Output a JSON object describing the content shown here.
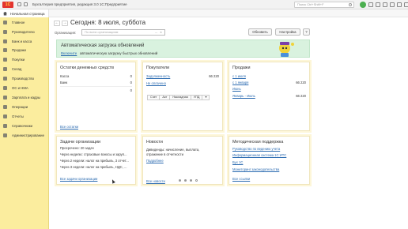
{
  "app": {
    "logo": "1С",
    "title": "Бухгалтерия предприятия, редакция 3.0 1С:Предприятие",
    "search_placeholder": "Поиск Ctrl+Shift+F"
  },
  "tabs": {
    "home": "Начальная страница"
  },
  "sidebar": {
    "items": [
      {
        "label": "Главное",
        "icon": "menu-icon"
      },
      {
        "label": "Руководителю",
        "icon": "chart-icon"
      },
      {
        "label": "Банк и касса",
        "icon": "bank-icon"
      },
      {
        "label": "Продажи",
        "icon": "cart-icon"
      },
      {
        "label": "Покупки",
        "icon": "basket-icon"
      },
      {
        "label": "Склад",
        "icon": "warehouse-icon"
      },
      {
        "label": "Производство",
        "icon": "factory-icon"
      },
      {
        "label": "ОС и НМА",
        "icon": "assets-icon"
      },
      {
        "label": "Зарплата и кадры",
        "icon": "person-icon"
      },
      {
        "label": "Операции",
        "icon": "operations-icon"
      },
      {
        "label": "Отчеты",
        "icon": "report-icon"
      },
      {
        "label": "Справочники",
        "icon": "book-icon"
      },
      {
        "label": "Администрирование",
        "icon": "gear-icon"
      }
    ]
  },
  "main": {
    "back": "←",
    "forward": "→",
    "title": "Сегодня: 8 июля, суббота",
    "org_label": "Организация:",
    "org_placeholder": "По всем организациям",
    "org_dots": "...",
    "org_clear": "×",
    "refresh_btn": "Обновить",
    "settings_btn": "Настройка",
    "help_btn": "?"
  },
  "banner": {
    "title": "Автоматическая загрузка обновлений",
    "link": "Включите",
    "text": "автоматическую загрузку быстрых обновлений"
  },
  "panels": {
    "cash": {
      "title": "Остатки денежных средств",
      "rows": [
        {
          "label": "Касса",
          "value": "0"
        },
        {
          "label": "Банк",
          "value": "0"
        },
        {
          "label": "",
          "value": "0"
        }
      ],
      "link": "Все остатки"
    },
    "buyers": {
      "title": "Покупатели",
      "rows": [
        {
          "label": "Задолженность",
          "value": "66 220"
        },
        {
          "label": "Не оплачено",
          "value": ""
        }
      ],
      "tabs": [
        "Счет",
        "Акт",
        "Накладная",
        "УПД",
        "▾"
      ]
    },
    "sales": {
      "title": "Продажи",
      "rows": [
        {
          "label": "с 1 июля",
          "value": ""
        },
        {
          "label": "с 1 января",
          "value": "66 220"
        },
        {
          "label": "Июнь",
          "value": ""
        },
        {
          "label": "Январь - Июль",
          "value": "66 220"
        }
      ]
    },
    "tasks": {
      "title": "Задачи организации",
      "rows": [
        "Просрочено: 20 задач",
        "Через неделю: страховые взносы и заруп...",
        "Через 2 недели: налог на прибыль, 3 отчет...",
        "Через 3 недели: налог на прибыль, НДС, ..."
      ],
      "link": "Все задачи организации"
    },
    "news": {
      "title": "Новости",
      "text1": "Дивиденды: начисление, выплата,",
      "text2": "отражение в отчетности",
      "link_more": "Подробнее",
      "link_all": "Все новости"
    },
    "support": {
      "title": "Методическая поддержка",
      "links": [
        "Руководство по ведению учета",
        "Информационная система 1С:ИТС",
        "Бух 1С",
        "Мониторинг законодательства"
      ],
      "link_all": "Все ссылки"
    }
  },
  "colors": {
    "sidebar_bg": "#fbed9e",
    "banner_bg": "#d9f2df",
    "link": "#2a6ab0",
    "logo_red": "#e3342f"
  }
}
